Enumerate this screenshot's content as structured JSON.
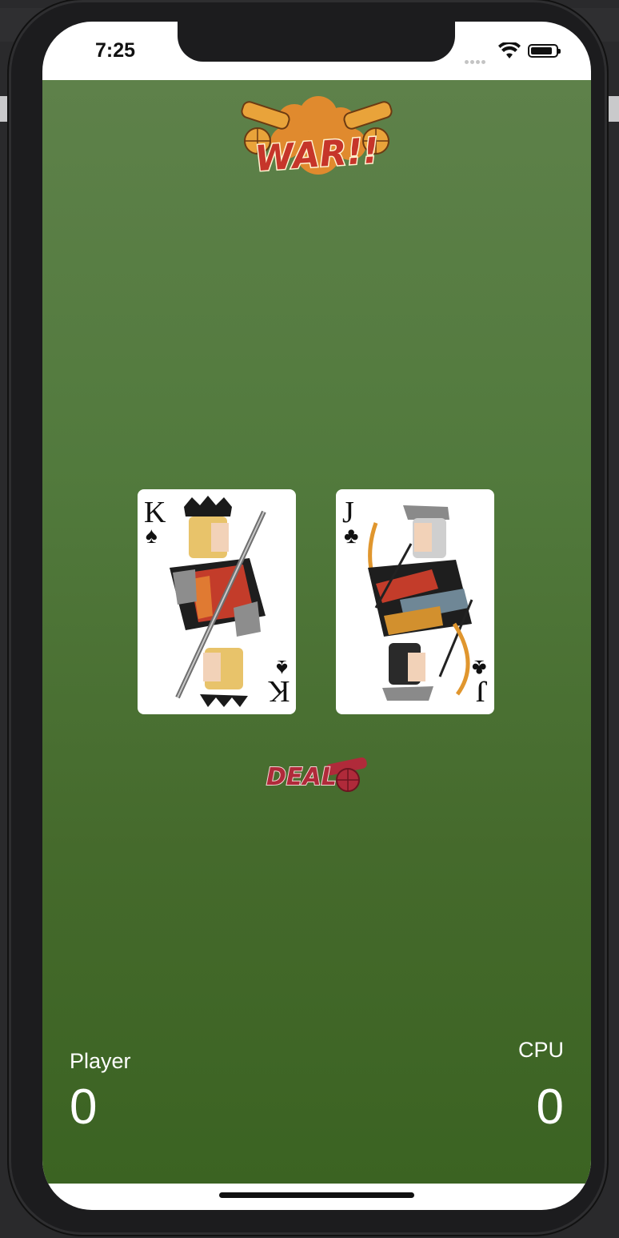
{
  "status_bar": {
    "time": "7:25"
  },
  "header": {
    "logo_text": "WAR!!"
  },
  "cards": {
    "player": {
      "rank": "K",
      "suit": "♠",
      "name": "King of Spades"
    },
    "cpu": {
      "rank": "J",
      "suit": "♣",
      "name": "Jack of Clubs"
    }
  },
  "deal_button": {
    "label": "DEAL"
  },
  "scores": {
    "player_label": "Player",
    "player_score": "0",
    "cpu_label": "CPU",
    "cpu_score": "0"
  },
  "colors": {
    "table_top": "#5e814a",
    "table_bottom": "#3b6322",
    "logo_orange": "#e08a2e",
    "logo_red": "#c6352a",
    "deal_red": "#b02a3a"
  }
}
